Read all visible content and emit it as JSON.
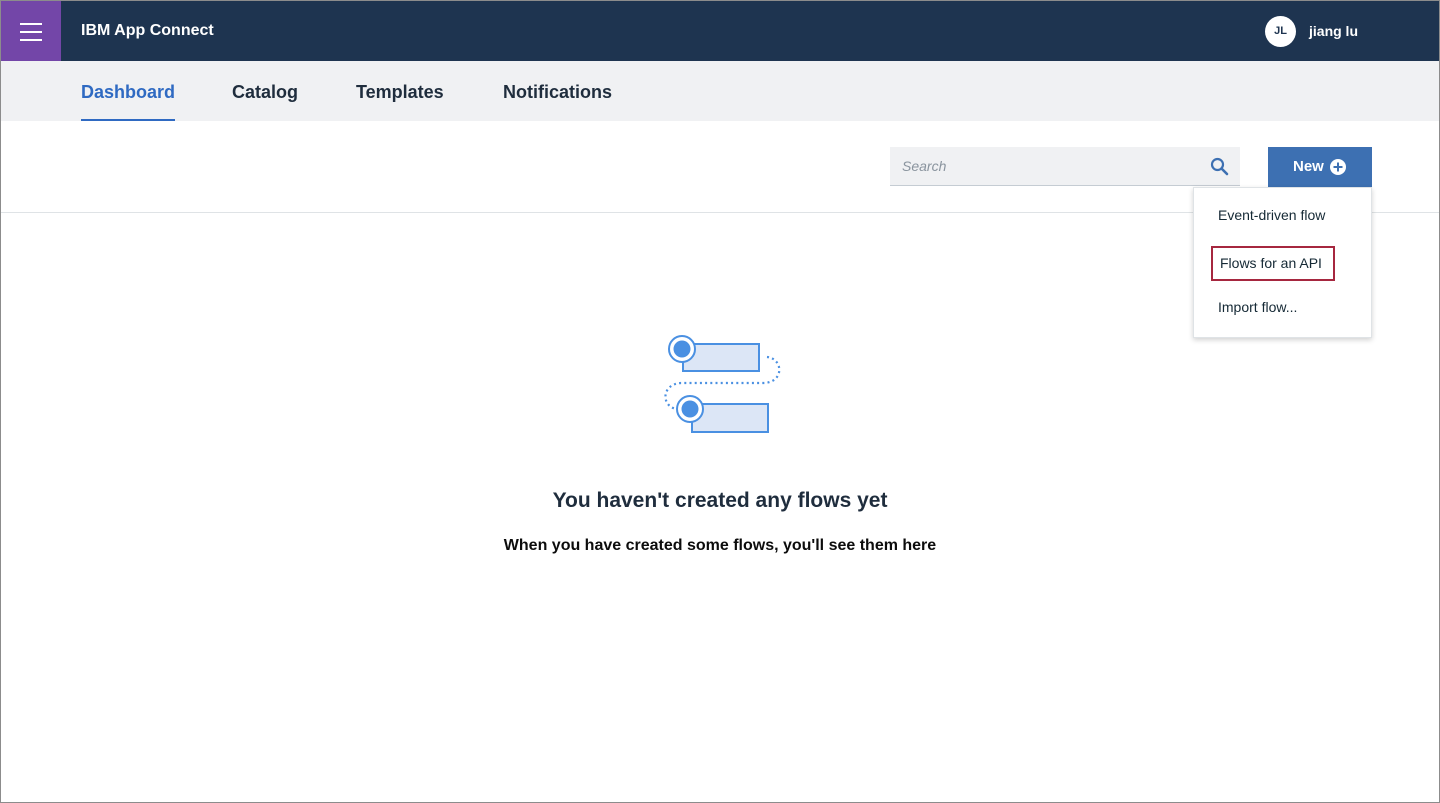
{
  "header": {
    "app_title": "IBM App Connect",
    "user_initials": "JL",
    "user_name": "jiang lu",
    "colors": {
      "header_bg": "#1e3450",
      "menu_bg": "#7346a8"
    }
  },
  "nav": {
    "tabs": [
      {
        "label": "Dashboard",
        "active": true
      },
      {
        "label": "Catalog",
        "active": false
      },
      {
        "label": "Templates",
        "active": false
      },
      {
        "label": "Notifications",
        "active": false
      }
    ]
  },
  "toolbar": {
    "search_placeholder": "Search",
    "search_value": "",
    "new_label": "New",
    "accent_color": "#3d70b2"
  },
  "new_menu": {
    "items": [
      {
        "label": "Event-driven flow",
        "highlighted": false
      },
      {
        "label": "Flows for an API",
        "highlighted": true
      },
      {
        "label": "Import flow...",
        "highlighted": false
      }
    ],
    "highlight_color": "#a6273f"
  },
  "empty_state": {
    "title": "You haven't created any flows yet",
    "subtitle": "When you have created some flows, you'll see them here",
    "icon": "flows-illustration"
  }
}
